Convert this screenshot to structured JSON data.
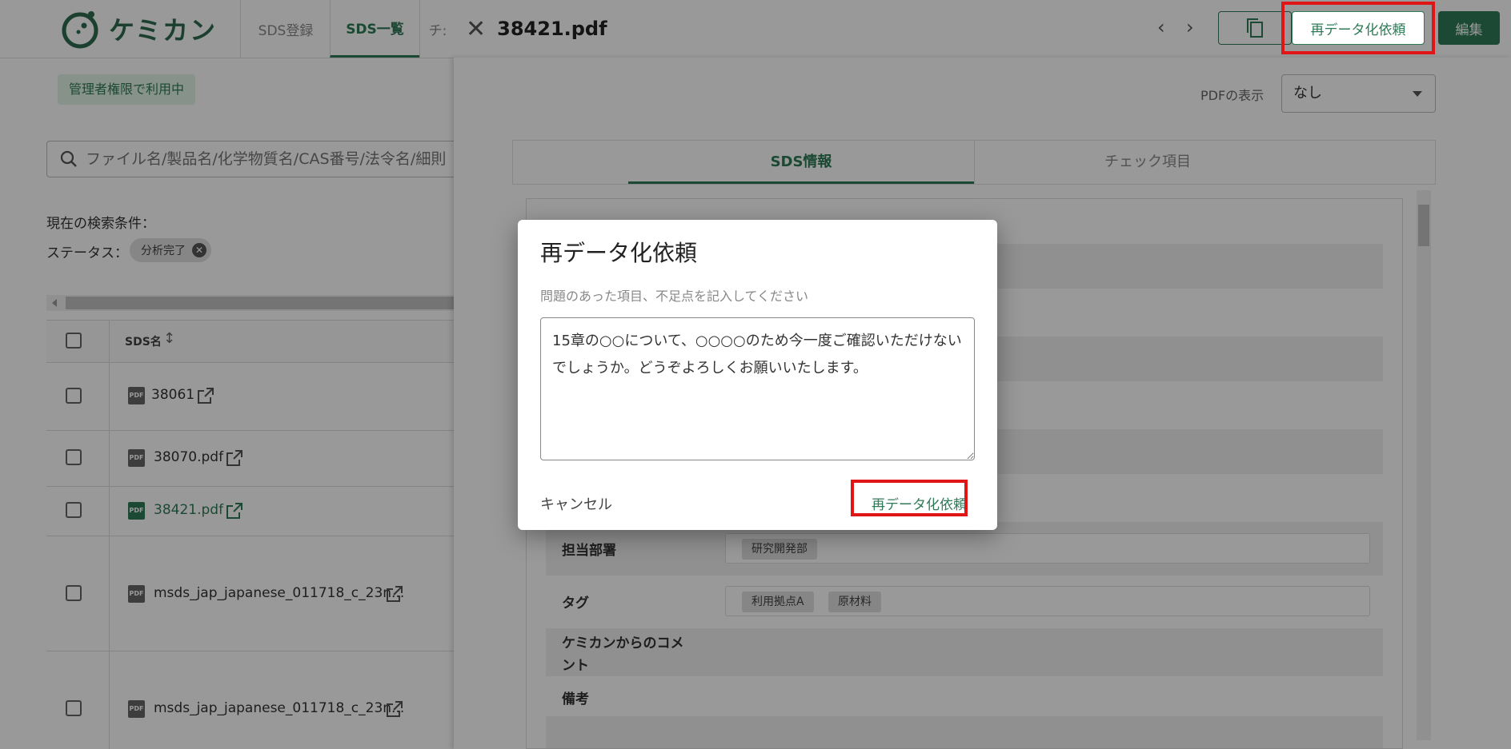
{
  "header": {
    "brand": "ケミカン",
    "nav": [
      {
        "label": "SDS登録"
      },
      {
        "label": "SDS一覧"
      },
      {
        "label": "チ:"
      }
    ],
    "panel_title": "38421.pdf",
    "copy_icon": "copy-icon",
    "re_data_button": "再データ化依頼",
    "edit_button": "編集"
  },
  "left": {
    "admin_badge": "管理者権限で利用中",
    "search_placeholder": "ファイル名/製品名/化学物質名/CAS番号/法令名/細則",
    "current_conditions": "現在の検索条件：",
    "status_label": "ステータス：",
    "status_chip": "分析完了",
    "col_header": "SDS名",
    "rows": [
      {
        "name": "38061"
      },
      {
        "name": "38070.pdf"
      },
      {
        "name": "38421.pdf"
      },
      {
        "name": "msds_jap_japanese_011718_c_23n..."
      },
      {
        "name": "msds_jap_japanese_011718_c_23n..."
      }
    ]
  },
  "panel": {
    "pdf_display_label": "PDFの表示",
    "pdf_display_value": "なし",
    "tabs": [
      {
        "label": "SDS情報"
      },
      {
        "label": "チェック項目"
      }
    ],
    "rows": {
      "dept_label": "担当部署",
      "dept_value": "研究開発部",
      "tag_label": "タグ",
      "tags": [
        "利用拠点A",
        "原材料"
      ],
      "comment_label_1": "ケミカンからのコメ",
      "comment_label_2": "ント",
      "remarks_label": "備考"
    }
  },
  "dialog": {
    "title": "再データ化依頼",
    "subtitle": "問題のあった項目、不足点を記入してください",
    "message": "15章の○○について、○○○○のため今一度ご確認いただけないでしょうか。どうぞよろしくお願いいたします。",
    "cancel": "キャンセル",
    "submit": "再データ化依頼"
  },
  "colors": {
    "accent": "#2f7a57",
    "highlight_frame": "#e01515",
    "overlay": "rgba(0,0,0,0.4)"
  }
}
